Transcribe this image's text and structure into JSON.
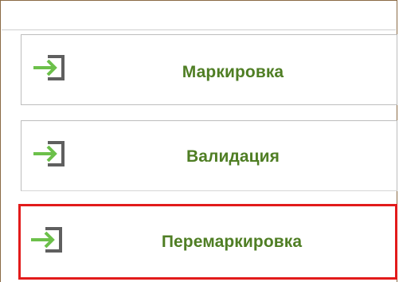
{
  "menu": {
    "items": [
      {
        "label": "Маркировка",
        "icon": "login-arrow-icon",
        "selected": false
      },
      {
        "label": "Валидация",
        "icon": "login-arrow-icon",
        "selected": false
      },
      {
        "label": "Перемаркировка",
        "icon": "login-arrow-icon",
        "selected": true
      }
    ]
  },
  "colors": {
    "label_green": "#4f7e24",
    "arrow_green": "#6cc04a",
    "bracket_gray": "#5f5f5f",
    "selection_red": "#e21b1b",
    "frame_brown": "#8a6a45"
  }
}
